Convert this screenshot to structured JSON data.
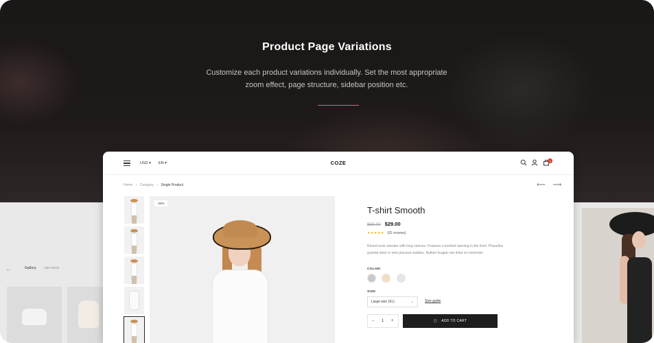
{
  "hero": {
    "title": "Product Page Variations",
    "subtitle_line1": "Customize each product variations individually. Set the most appropriate",
    "subtitle_line2": "zoom effect, page structure, sidebar position etc.",
    "accent_color": "#c76b8c"
  },
  "background_shop": {
    "filter_label": "Gallery",
    "filter_secondary": "sale skirts"
  },
  "header": {
    "currency": "USD ▾",
    "language": "EN ▾",
    "brand": "COZE",
    "icons": [
      "menu-icon",
      "search-icon",
      "user-icon",
      "cart-icon"
    ],
    "cart_count": "0"
  },
  "breadcrumb": {
    "home": "Home",
    "category": "Category",
    "current": "Single Product",
    "separator": "›"
  },
  "nav": {
    "prev": "⟵",
    "next": "⟶"
  },
  "product": {
    "sale_badge": "-20%",
    "title": "T-shirt Smooth",
    "old_price": "$59.00",
    "price": "$29.00",
    "stars": "★★★★★",
    "reviews": "(02 reviews)",
    "description": "Round neck sweater with long sleeves. Features a knotted opening in the front. Phasellus gravida dolor in sem placerat sodales. Nullam feugiat non dolor id commodo.",
    "color_label": "COLOR:",
    "colors": [
      "#c9c9c9",
      "#f3dcc4",
      "#e6e6e6"
    ],
    "size_label": "SIZE:",
    "size_value": "Large size (XL)",
    "size_guide": "Size guide",
    "quantity": "1",
    "add_to_cart": "ADD TO CART"
  }
}
